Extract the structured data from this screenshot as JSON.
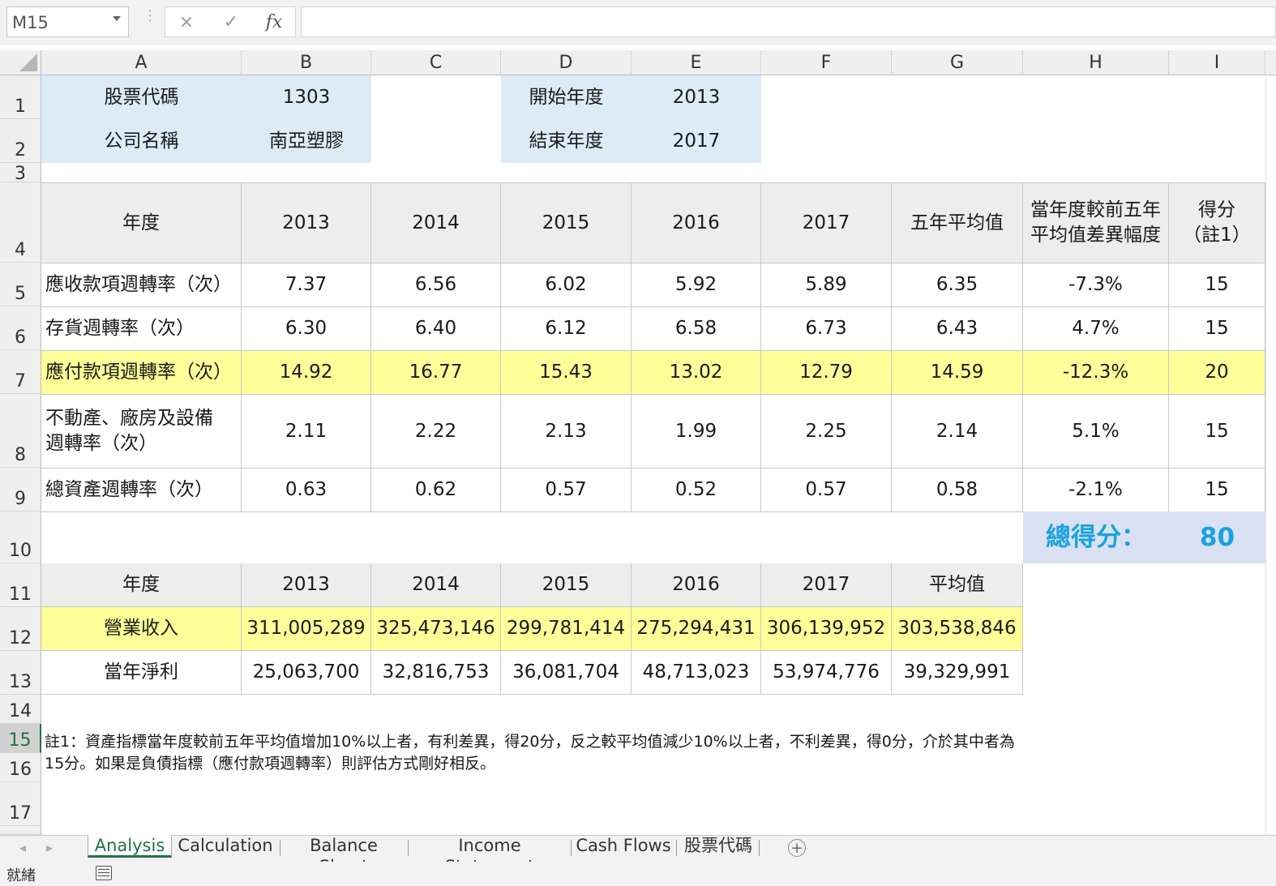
{
  "name_box": "M15",
  "formula_icons": {
    "cancel": "×",
    "enter": "✓",
    "fx": "fx"
  },
  "columns": [
    "A",
    "B",
    "C",
    "D",
    "E",
    "F",
    "G",
    "H",
    "I"
  ],
  "rows": [
    "1",
    "2",
    "3",
    "4",
    "5",
    "6",
    "7",
    "8",
    "9",
    "10",
    "11",
    "12",
    "13",
    "14",
    "15",
    "16",
    "17"
  ],
  "info": {
    "stock_code_label": "股票代碼",
    "stock_code": "1303",
    "company_label": "公司名稱",
    "company": "南亞塑膠",
    "start_label": "開始年度",
    "start_year": "2013",
    "end_label": "結束年度",
    "end_year": "2017"
  },
  "ratio_table": {
    "headers": [
      "年度",
      "2013",
      "2014",
      "2015",
      "2016",
      "2017",
      "五年平均值",
      "當年度較前五年\n平均值差異幅度",
      "得分\n（註1）"
    ],
    "rows": [
      [
        "應收款項週轉率（次）",
        "7.37",
        "6.56",
        "6.02",
        "5.92",
        "5.89",
        "6.35",
        "-7.3%",
        "15"
      ],
      [
        "存貨週轉率（次）",
        "6.30",
        "6.40",
        "6.12",
        "6.58",
        "6.73",
        "6.43",
        "4.7%",
        "15"
      ],
      [
        "應付款項週轉率（次）",
        "14.92",
        "16.77",
        "15.43",
        "13.02",
        "12.79",
        "14.59",
        "-12.3%",
        "20"
      ],
      [
        "不動產、廠房及設備\n週轉率（次）",
        "2.11",
        "2.22",
        "2.13",
        "1.99",
        "2.25",
        "2.14",
        "5.1%",
        "15"
      ],
      [
        "總資產週轉率（次）",
        "0.63",
        "0.62",
        "0.57",
        "0.52",
        "0.57",
        "0.58",
        "-2.1%",
        "15"
      ]
    ]
  },
  "total": {
    "label": "總得分：",
    "value": "80"
  },
  "income_table": {
    "headers": [
      "年度",
      "2013",
      "2014",
      "2015",
      "2016",
      "2017",
      "平均值"
    ],
    "rows": [
      [
        "營業收入",
        "311,005,289",
        "325,473,146",
        "299,781,414",
        "275,294,431",
        "306,139,952",
        "303,538,846"
      ],
      [
        "當年淨利",
        "25,063,700",
        "32,816,753",
        "36,081,704",
        "48,713,023",
        "53,974,776",
        "39,329,991"
      ]
    ]
  },
  "note": "註1：資產指標當年度較前五年平均值增加10%以上者，有利差異，得20分，反之較平均值減少10%以上者，不利差異，得0分，介於其中者為15分。如果是負債指標（應付款項週轉率）則評估方式剛好相反。",
  "tabs": [
    "Analysis",
    "Calculation",
    "Balance Sheet",
    "Income Statement",
    "Cash Flows",
    "股票代碼"
  ],
  "active_tab": "Analysis",
  "status": "就緒",
  "colors": {
    "accent_total": "#19a2e0",
    "active_tab": "#217346",
    "highlight_row": "#ffff99"
  }
}
